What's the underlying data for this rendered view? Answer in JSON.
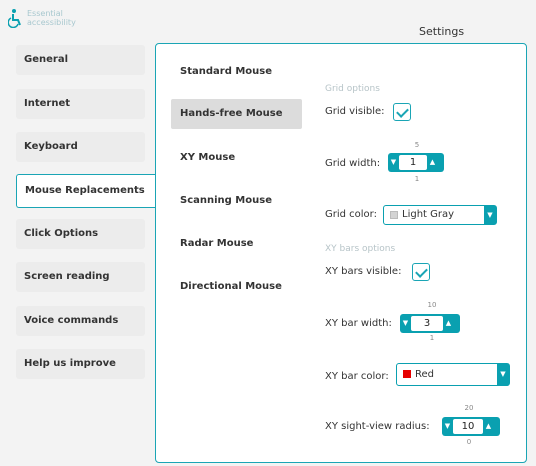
{
  "app": {
    "logo_line1": "Essential",
    "logo_line2": "accessibility",
    "title": "Settings"
  },
  "nav": {
    "items": [
      "General",
      "Internet",
      "Keyboard",
      "Mouse Replacements",
      "Click Options",
      "Screen reading",
      "Voice commands",
      "Help us improve"
    ],
    "active": "Mouse Replacements"
  },
  "submenu": {
    "items": [
      "Standard Mouse",
      "Hands-free Mouse",
      "XY Mouse",
      "Scanning Mouse",
      "Radar Mouse",
      "Directional Mouse"
    ],
    "active": "Hands-free Mouse"
  },
  "grid": {
    "section_label": "Grid options",
    "visible_label": "Grid visible:",
    "visible": true,
    "width_label": "Grid width:",
    "width_value": "1",
    "width_max": "5",
    "width_min": "1",
    "color_label": "Grid color:",
    "color_value": "Light Gray",
    "color_swatch": "#d3d3d3"
  },
  "xy": {
    "section_label": "XY bars options",
    "visible_label": "XY bars visible:",
    "visible": true,
    "width_label": "XY bar width:",
    "width_value": "3",
    "width_max": "10",
    "width_min": "1",
    "color_label": "XY bar color:",
    "color_value": "Red",
    "color_swatch": "#e60000",
    "radius_label": "XY sight-view radius:",
    "radius_value": "10",
    "radius_max": "20",
    "radius_min": "0"
  },
  "colors": {
    "accent": "#1aa5b5"
  }
}
